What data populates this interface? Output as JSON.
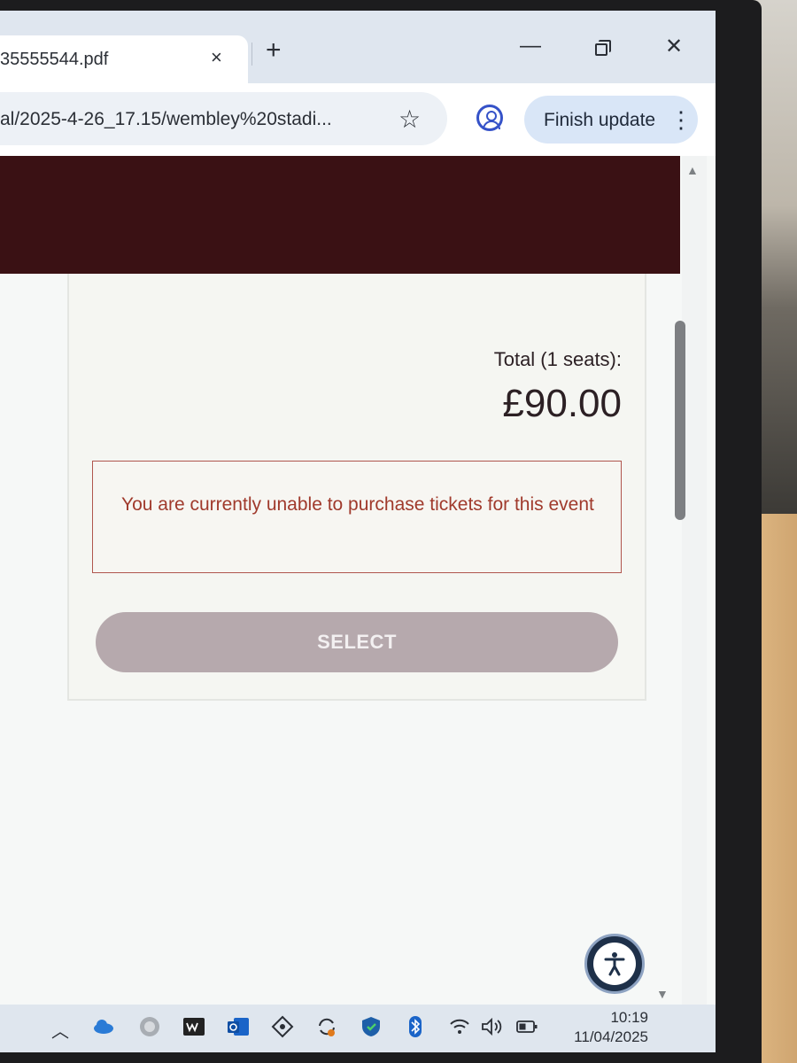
{
  "browser": {
    "tab_title": "35555544.pdf",
    "tab_close_icon": "×",
    "new_tab_icon": "+",
    "url": "al/2025-4-26_17.15/wembley%20stadi...",
    "update_button_label": "Finish update",
    "accent_color": "#3552c8"
  },
  "purchase": {
    "total_label": "Total (1 seats):",
    "total_amount": "£90.00",
    "error_message": "You are currently unable to purchase tickets for this event",
    "select_button_label": "SELECT"
  },
  "colors": {
    "banner": "#3a1114",
    "error_text": "#a03a2c",
    "error_border": "#b0564e",
    "select_button": "#b6a9ad"
  },
  "taskbar": {
    "time": "10:19",
    "date": "11/04/2025",
    "icons": [
      "chevron-up-icon",
      "onedrive-cloud-icon",
      "app-circle-icon",
      "w-app-icon",
      "outlook-icon",
      "network-tool-icon",
      "sync-icon",
      "defender-shield-icon",
      "bluetooth-icon",
      "wifi-icon",
      "volume-icon",
      "battery-icon"
    ]
  }
}
